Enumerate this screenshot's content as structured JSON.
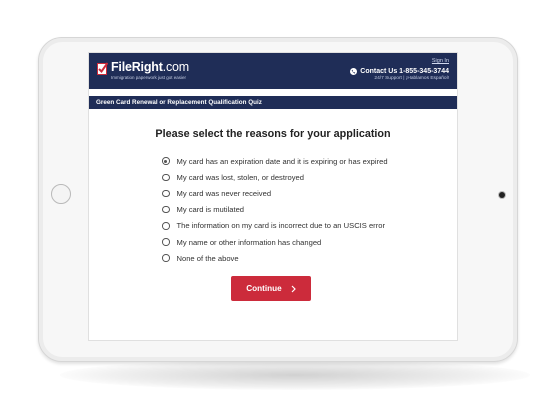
{
  "header": {
    "brand_name": "FileRight",
    "brand_tld": ".com",
    "tagline": "Immigration paperwork just got easier",
    "sign_in": "Sign In",
    "contact": "Contact Us 1-855-345-3744",
    "support": "24/7 Support | ¡Hablamos Español!"
  },
  "quiz": {
    "title": "Green Card Renewal or Replacement Qualification Quiz",
    "question": "Please select the reasons for your application",
    "options": [
      {
        "label": "My card has an expiration date and it is expiring or has expired",
        "selected": true
      },
      {
        "label": "My card was lost, stolen, or destroyed",
        "selected": false
      },
      {
        "label": "My card was never received",
        "selected": false
      },
      {
        "label": "My card is mutilated",
        "selected": false
      },
      {
        "label": "The information on my card is incorrect due to an USCIS error",
        "selected": false
      },
      {
        "label": "My name or other information has changed",
        "selected": false
      },
      {
        "label": "None of the above",
        "selected": false
      }
    ],
    "continue_label": "Continue"
  },
  "colors": {
    "header_bg": "#1f2d57",
    "button_bg": "#cc2b3b",
    "logo_check": "#cc2b3b"
  },
  "icons": {
    "logo": "checkmark-document-icon",
    "phone": "phone-icon",
    "continue": "chevron-right-icon"
  }
}
